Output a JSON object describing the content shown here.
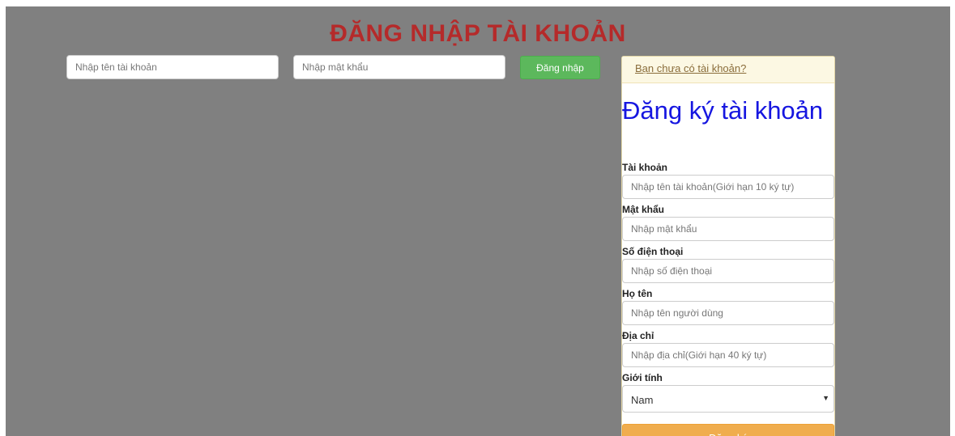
{
  "header": {
    "title": "ĐĂNG NHẬP TÀI KHOẢN"
  },
  "login": {
    "username_placeholder": "Nhập tên tài khoản",
    "password_placeholder": "Nhập mật khẩu",
    "submit_label": "Đăng nhập"
  },
  "register": {
    "prompt_link": "Bạn chưa có tài khoản?",
    "title": "Đăng ký tài khoản",
    "fields": {
      "username": {
        "label": "Tài khoản",
        "placeholder": "Nhập tên tài khoản(Giới hạn 10 ký tự)"
      },
      "password": {
        "label": "Mật khẩu",
        "placeholder": "Nhập mật khẩu"
      },
      "phone": {
        "label": "Số điện thoại",
        "placeholder": "Nhập số điện thoại"
      },
      "fullname": {
        "label": "Họ tên",
        "placeholder": "Nhập tên người dùng"
      },
      "address": {
        "label": "Địa chỉ",
        "placeholder": "Nhập địa chỉ(Giới hạn 40 ký tự)"
      },
      "gender": {
        "label": "Giới tính",
        "selected": "Nam"
      }
    },
    "submit_label": "Đăng ký"
  },
  "colors": {
    "background": "#808080",
    "title": "#b52a2a",
    "login_button": "#5cb85c",
    "register_title": "#1616e0",
    "register_button": "#f0ad4e",
    "panel_header": "#fcf8e3"
  },
  "icons": {
    "select_arrow": "caret-down-icon"
  }
}
